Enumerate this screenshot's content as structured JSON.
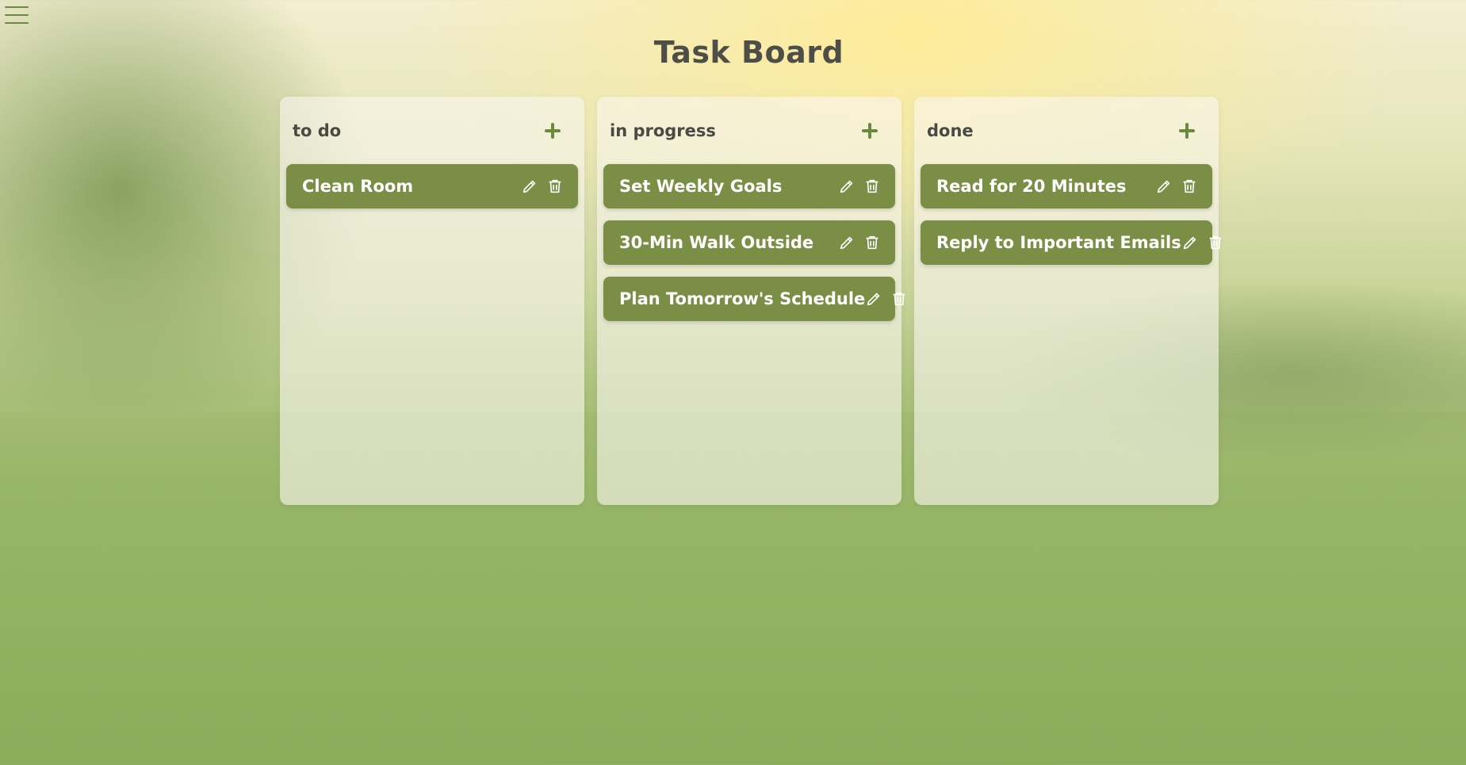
{
  "app": {
    "title": "Task Board",
    "menu_icon": "hamburger-menu-icon"
  },
  "colors": {
    "card": "#7a8f45",
    "accent": "#6a8a3e",
    "title": "#4e4e48"
  },
  "columns": [
    {
      "title": "to do",
      "add_icon": "plus-icon",
      "cards": [
        {
          "title": "Clean Room"
        }
      ]
    },
    {
      "title": "in progress",
      "add_icon": "plus-icon",
      "cards": [
        {
          "title": "Set Weekly Goals"
        },
        {
          "title": "30-Min Walk Outside"
        },
        {
          "title": "Plan Tomorrow's Schedule"
        }
      ]
    },
    {
      "title": "done",
      "add_icon": "plus-icon",
      "cards": [
        {
          "title": "Read for 20 Minutes"
        },
        {
          "title": "Reply to Important Emails"
        }
      ]
    }
  ],
  "card_actions": {
    "edit_icon": "pencil-icon",
    "delete_icon": "trash-icon"
  }
}
